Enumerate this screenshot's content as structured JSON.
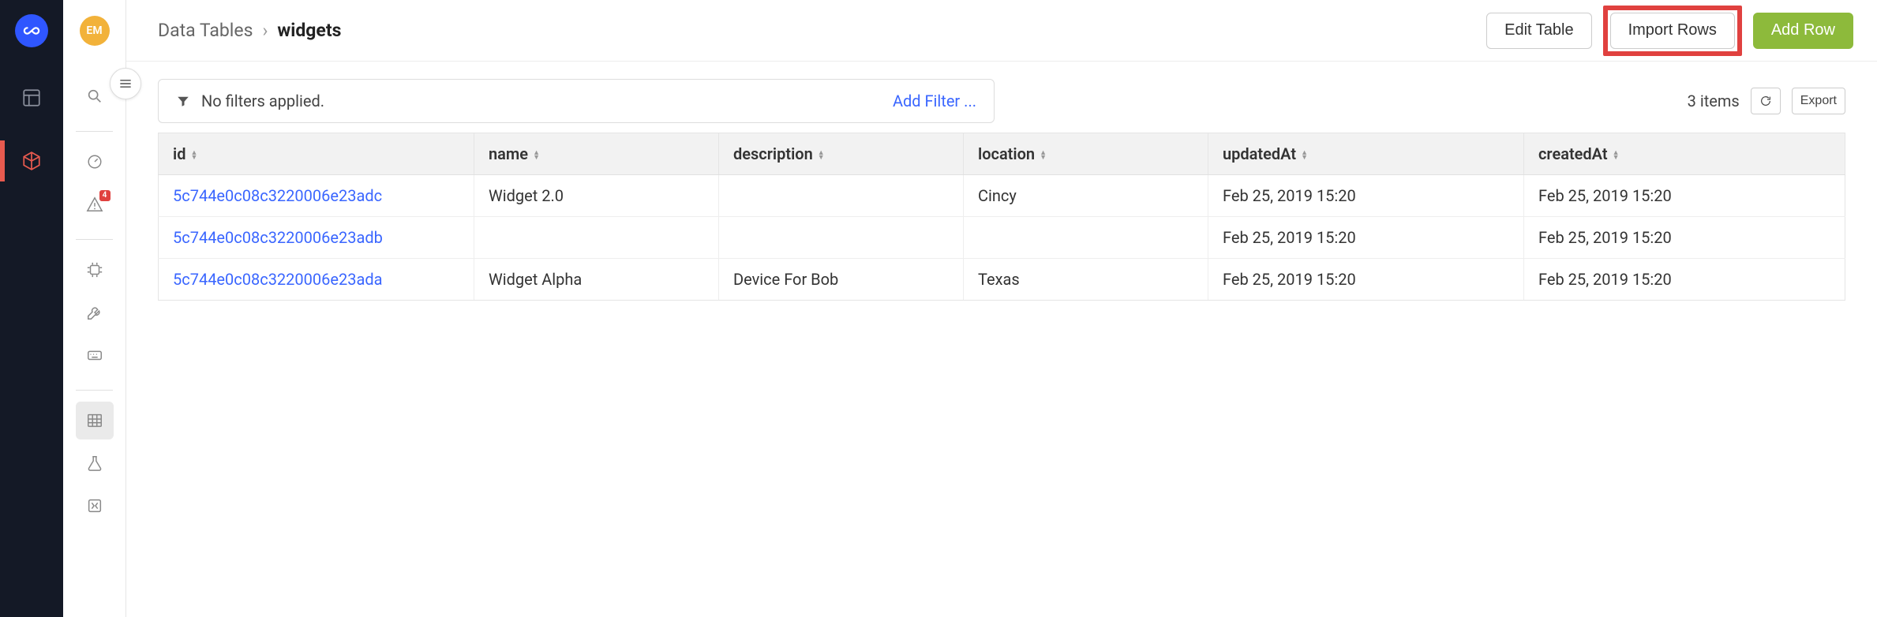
{
  "avatar_initials": "EM",
  "topbar": {
    "breadcrumb_root": "Data Tables",
    "breadcrumb_sep": "›",
    "breadcrumb_current": "widgets",
    "edit_table_label": "Edit Table",
    "import_rows_label": "Import Rows",
    "add_row_label": "Add Row"
  },
  "filters": {
    "status_text": "No filters applied.",
    "add_filter_label": "Add Filter ..."
  },
  "toolbar": {
    "item_count_text": "3 items",
    "export_label": "Export"
  },
  "sidebar2": {
    "alert_badge": "4"
  },
  "table": {
    "columns": [
      {
        "key": "id",
        "label": "id"
      },
      {
        "key": "name",
        "label": "name"
      },
      {
        "key": "description",
        "label": "description"
      },
      {
        "key": "location",
        "label": "location"
      },
      {
        "key": "updatedAt",
        "label": "updatedAt"
      },
      {
        "key": "createdAt",
        "label": "createdAt"
      }
    ],
    "rows": [
      {
        "id": "5c744e0c08c3220006e23adc",
        "name": "Widget 2.0",
        "description": "",
        "location": "Cincy",
        "updatedAt": "Feb 25, 2019 15:20",
        "createdAt": "Feb 25, 2019 15:20"
      },
      {
        "id": "5c744e0c08c3220006e23adb",
        "name": "",
        "description": "",
        "location": "",
        "updatedAt": "Feb 25, 2019 15:20",
        "createdAt": "Feb 25, 2019 15:20"
      },
      {
        "id": "5c744e0c08c3220006e23ada",
        "name": "Widget Alpha",
        "description": "Device For Bob",
        "location": "Texas",
        "updatedAt": "Feb 25, 2019 15:20",
        "createdAt": "Feb 25, 2019 15:20"
      }
    ]
  }
}
